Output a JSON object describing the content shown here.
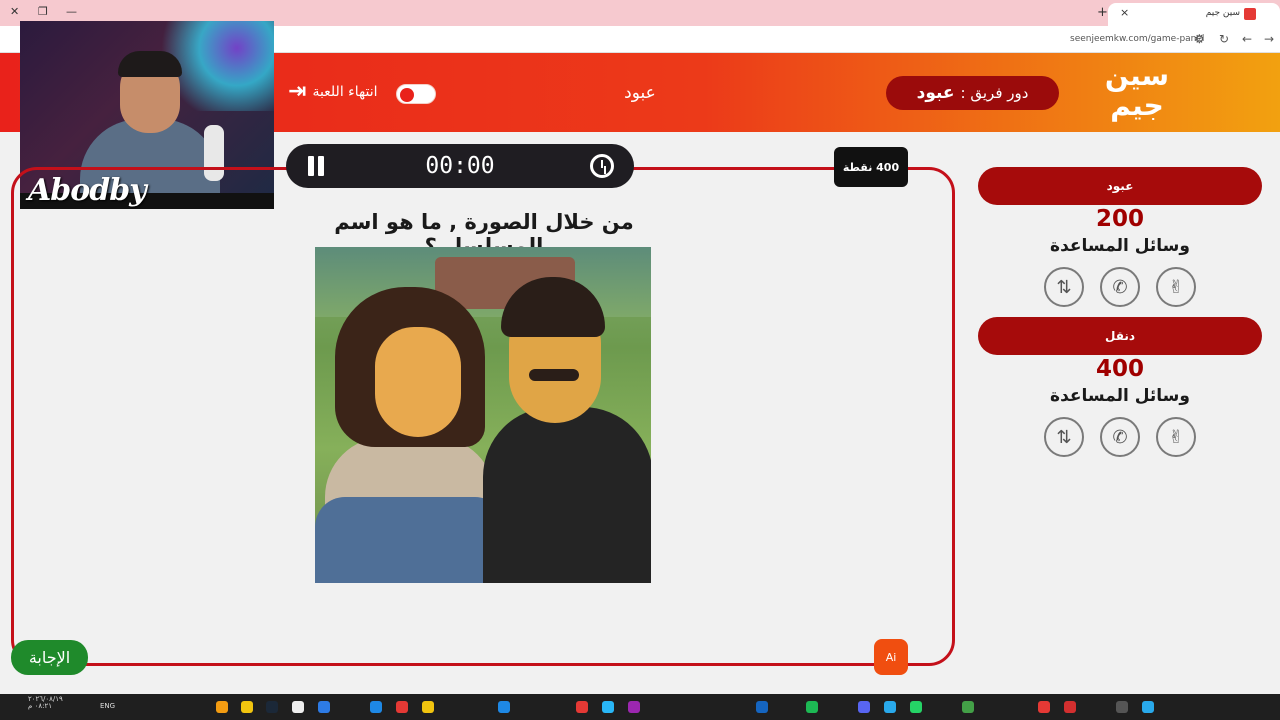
{
  "browser": {
    "tab_title": "سين جيم",
    "url": "seenjeemkw.com/game-panel",
    "close_glyph": "×",
    "new_tab_glyph": "+"
  },
  "header": {
    "logo_text": "سين جيم",
    "turn_label": "دور فريق :",
    "turn_team": "عبود",
    "current_team": "عبود",
    "end_game_label": "انتهاء اللعبة",
    "toggle_on": false
  },
  "webcam": {
    "name": "Abodby"
  },
  "question": {
    "timer": "00:00",
    "points_badge": "400 نقطة",
    "text": "من خلال الصورة , ما هو اسم المسلسل ؟",
    "answer_button": "الإجابة",
    "ai_badge": "Ai"
  },
  "teams": [
    {
      "name": "عبود",
      "score": "200",
      "helpers_label": "وسائل المساعدة"
    },
    {
      "name": "دنقل",
      "score": "400",
      "helpers_label": "وسائل المساعدة"
    }
  ],
  "helpers": [
    {
      "name": "two-answers-icon",
      "glyph": "✌"
    },
    {
      "name": "phone-call-icon",
      "glyph": "✆"
    },
    {
      "name": "swap-question-icon",
      "glyph": "⇅"
    }
  ],
  "taskbar": {
    "lang": "ENG",
    "time": "٠٨:٢١ م",
    "date": "٢٠٢٦/٠٨/١٩"
  },
  "colors": {
    "header_red": "#e9221b",
    "header_orange": "#f2a110",
    "team_bar": "#a60b0b",
    "panel_border": "#c4101a",
    "answer_green": "#1f8a2b",
    "ai_orange": "#f04e10"
  }
}
